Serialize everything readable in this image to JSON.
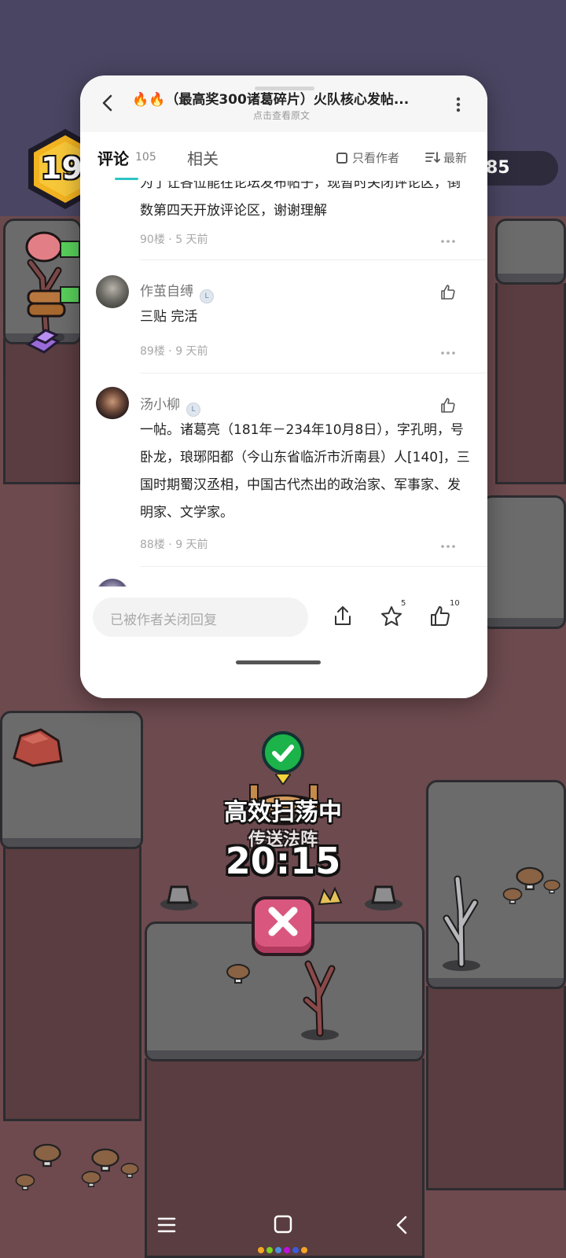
{
  "game": {
    "level": "19",
    "coins": "85",
    "sweep_status": "高效扫荡中",
    "sweep_sub": "传送法阵",
    "timer": "20:15"
  },
  "post": {
    "title": "🔥🔥（最高奖300诸葛碎片）火队核心发帖...",
    "subtitle": "点击查看原文"
  },
  "tabs": {
    "comments_label": "评论",
    "comments_count": "105",
    "related_label": "相关",
    "only_author_label": "只看作者",
    "sort_label": "最新"
  },
  "comments": [
    {
      "text": "为了让各位能在论坛发布帖子，现暂时关闭评论区，倒数第四天开放评论区，谢谢理解",
      "floor": "90楼",
      "time": "5 天前"
    },
    {
      "user": "作茧自缚",
      "text": "三贴 完活",
      "floor": "89楼",
      "time": "9 天前"
    },
    {
      "user": "汤小柳",
      "text": "一帖。诸葛亮（181年－234年10月8日），字孔明，号卧龙，琅琊阳都（今山东省临沂市沂南县）人[140]，三国时期蜀汉丞相，中国古代杰出的政治家、军事家、发明家、文学家。",
      "floor": "88楼",
      "time": "9 天前"
    }
  ],
  "bottom": {
    "reply_placeholder": "已被作者关闭回复",
    "star_count": "5",
    "like_count": "10"
  },
  "colors": {
    "accent": "#2ec4c4",
    "sky": "#4a4562",
    "ground": "#6e4a4f"
  },
  "icons": [
    "back-icon",
    "more-icon",
    "sort-icon",
    "like-icon",
    "share-icon",
    "star-icon",
    "check-icon",
    "close-icon",
    "menu-icon",
    "home-icon",
    "nav-back-icon"
  ]
}
